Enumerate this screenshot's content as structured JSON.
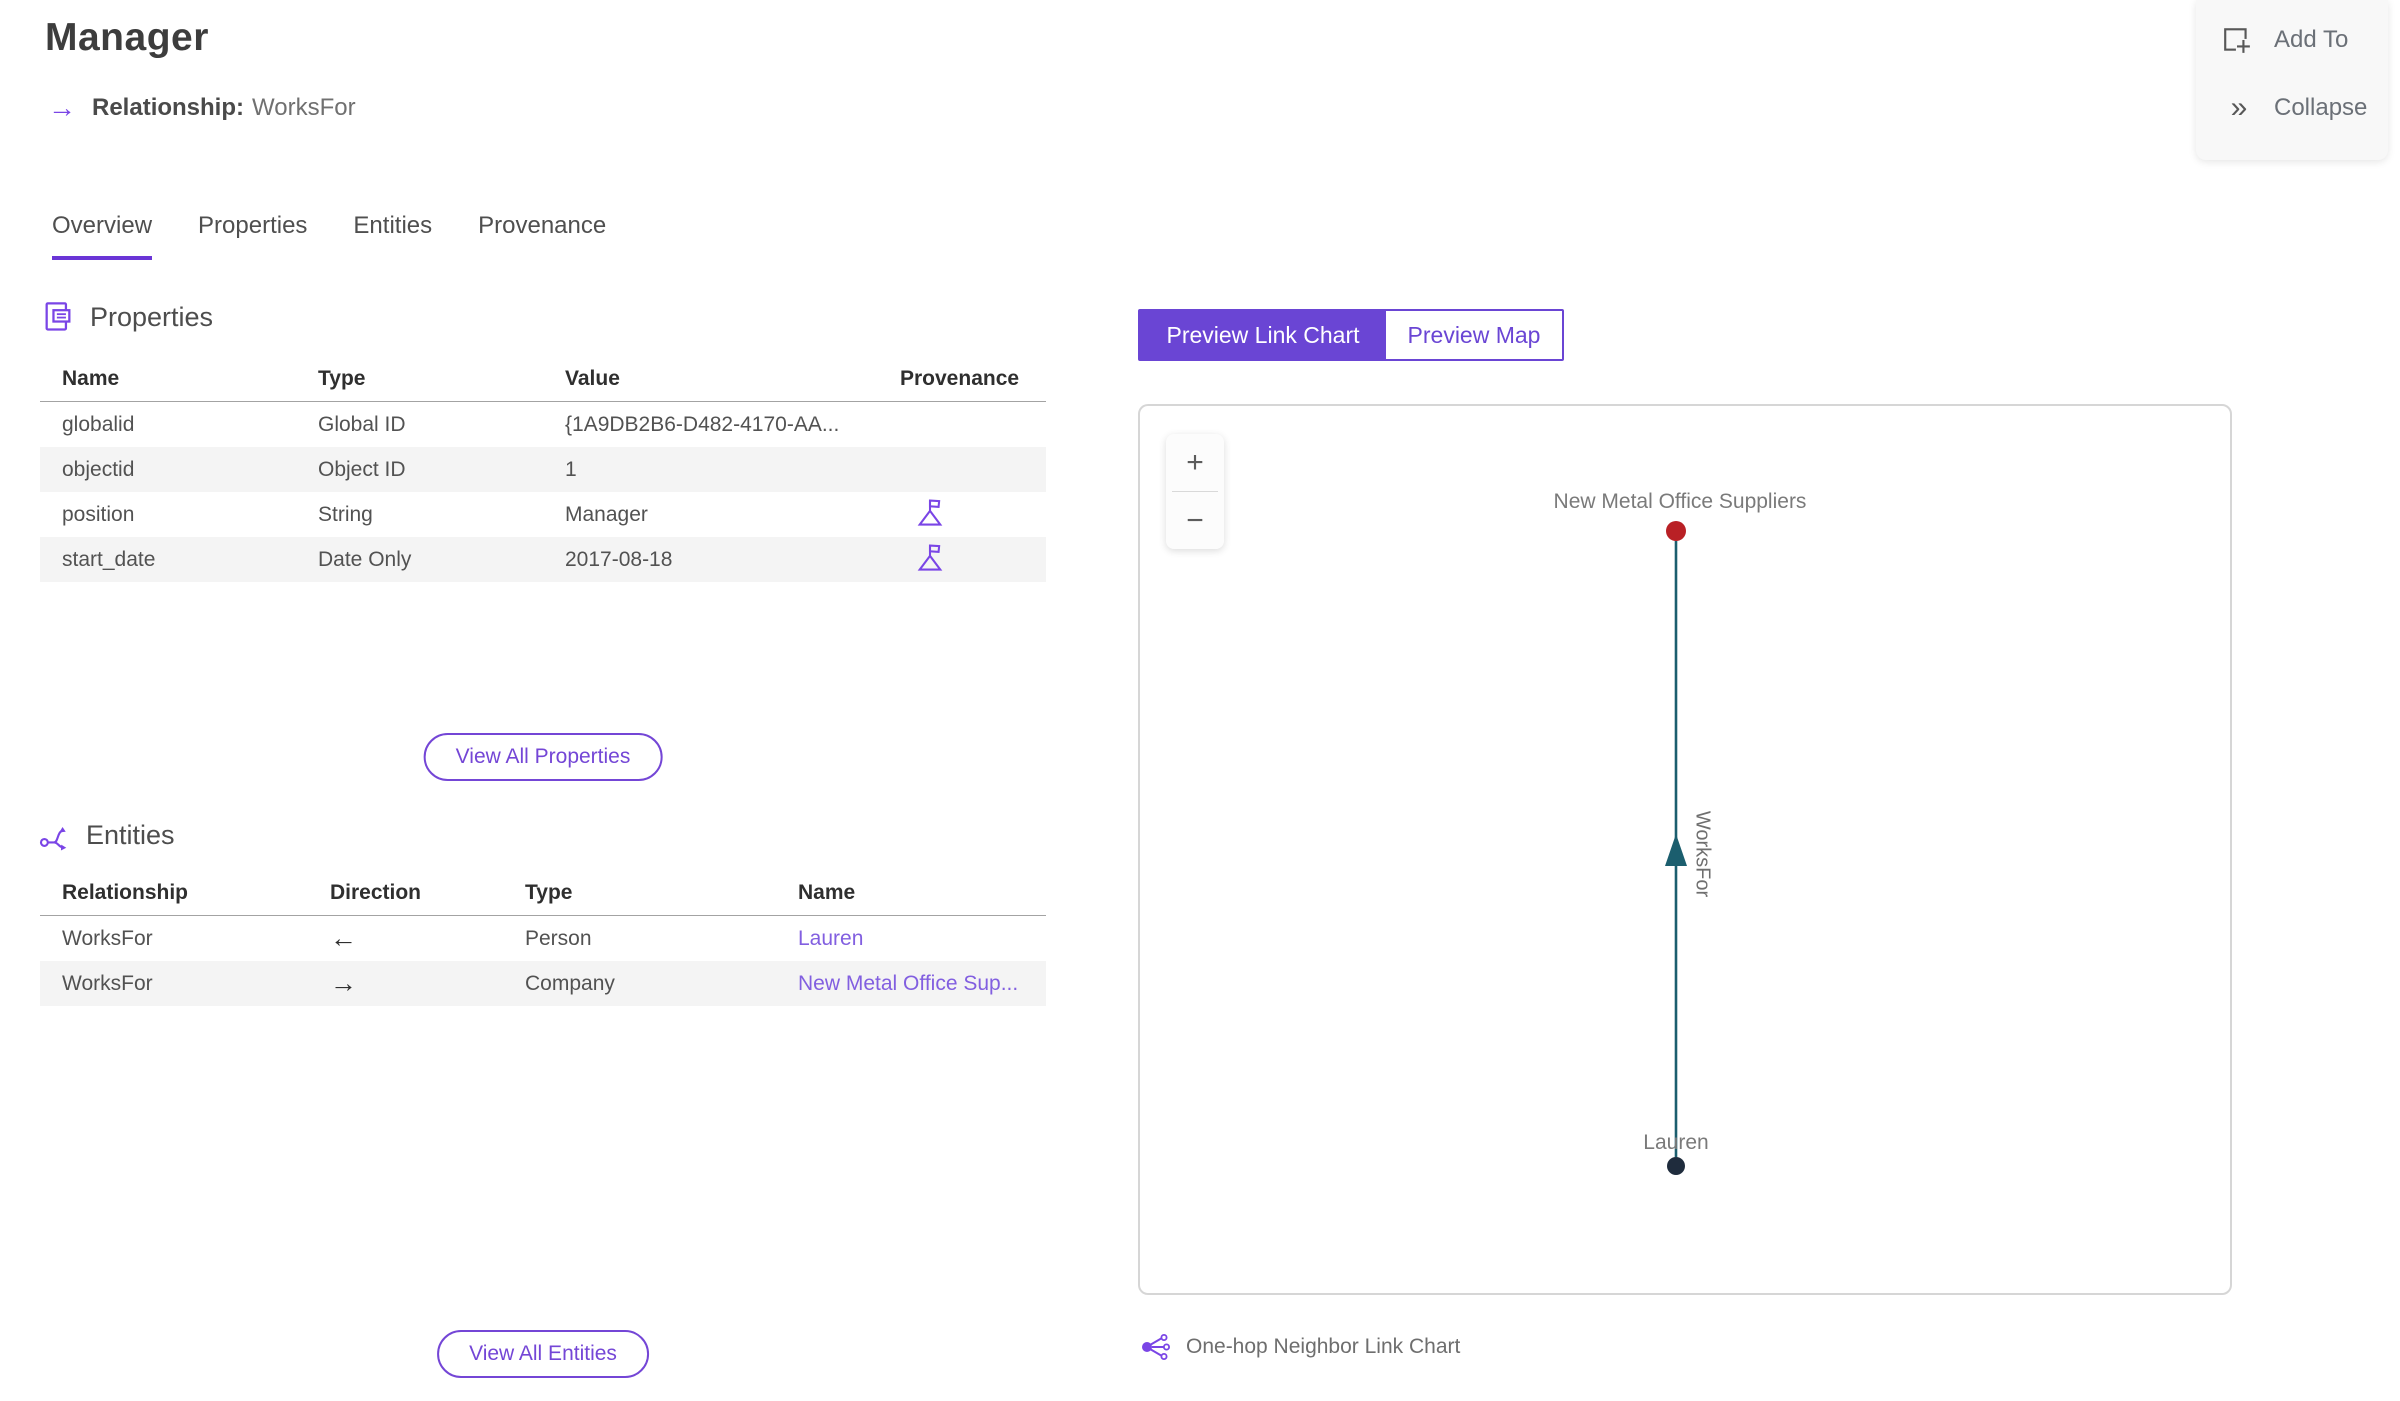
{
  "header": {
    "title": "Manager",
    "relationship_label": "Relationship:",
    "relationship_value": "WorksFor"
  },
  "actions": {
    "add_to_label": "Add To",
    "collapse_label": "Collapse"
  },
  "tabs": [
    {
      "label": "Overview",
      "active": true
    },
    {
      "label": "Properties",
      "active": false
    },
    {
      "label": "Entities",
      "active": false
    },
    {
      "label": "Provenance",
      "active": false
    }
  ],
  "properties_section": {
    "title": "Properties",
    "columns": {
      "name": "Name",
      "type": "Type",
      "value": "Value",
      "provenance": "Provenance"
    },
    "rows": [
      {
        "name": "globalid",
        "type": "Global ID",
        "value": "{1A9DB2B6-D482-4170-AA...",
        "has_provenance": false
      },
      {
        "name": "objectid",
        "type": "Object ID",
        "value": "1",
        "has_provenance": false
      },
      {
        "name": "position",
        "type": "String",
        "value": "Manager",
        "has_provenance": true
      },
      {
        "name": "start_date",
        "type": "Date Only",
        "value": "2017-08-18",
        "has_provenance": true
      }
    ],
    "view_all_label": "View All Properties"
  },
  "entities_section": {
    "title": "Entities",
    "columns": {
      "relationship": "Relationship",
      "direction": "Direction",
      "type": "Type",
      "name": "Name"
    },
    "rows": [
      {
        "relationship": "WorksFor",
        "direction": "←",
        "type": "Person",
        "name": "Lauren"
      },
      {
        "relationship": "WorksFor",
        "direction": "→",
        "type": "Company",
        "name": "New Metal Office Sup..."
      }
    ],
    "view_all_label": "View All Entities"
  },
  "preview": {
    "toggle": {
      "link_chart_label": "Preview Link Chart",
      "map_label": "Preview Map"
    },
    "zoom_in": "+",
    "zoom_out": "−",
    "caption": "One-hop Neighbor Link Chart"
  },
  "chart_data": {
    "type": "link-chart",
    "nodes": [
      {
        "label": "New Metal Office Suppliers",
        "entity_type": "Company",
        "color": "#b92025",
        "position": "top"
      },
      {
        "label": "Lauren",
        "entity_type": "Person",
        "color": "#1f2c3d",
        "position": "bottom"
      }
    ],
    "edges": [
      {
        "label": "WorksFor",
        "from": "Lauren",
        "to": "New Metal Office Suppliers",
        "color": "#1b5e6e",
        "direction": "up"
      }
    ]
  },
  "colors": {
    "accent_purple": "#6a45d4",
    "icon_purple": "#7a45e6",
    "link_purple": "#825fe0",
    "node_red": "#b92025",
    "node_navy": "#1f2c3d",
    "edge_teal": "#1b5e6e",
    "row_stripe": "#f4f4f4"
  }
}
